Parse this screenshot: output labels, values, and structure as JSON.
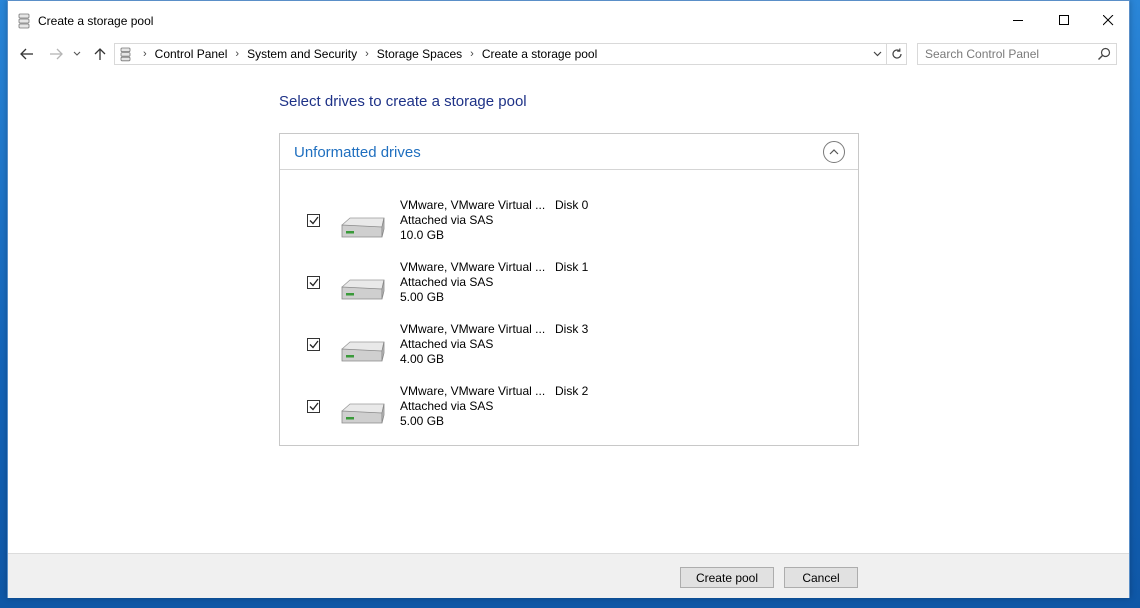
{
  "window": {
    "title": "Create a storage pool"
  },
  "breadcrumb": {
    "items": [
      "Control Panel",
      "System and Security",
      "Storage Spaces",
      "Create a storage pool"
    ]
  },
  "search": {
    "placeholder": "Search Control Panel"
  },
  "main": {
    "heading": "Select drives to create a storage pool",
    "section_title": "Unformatted drives",
    "drives": [
      {
        "name": "VMware, VMware Virtual ...",
        "disk": "Disk 0",
        "connection": "Attached via SAS",
        "size": "10.0 GB",
        "checked": true
      },
      {
        "name": "VMware, VMware Virtual ...",
        "disk": "Disk 1",
        "connection": "Attached via SAS",
        "size": "5.00 GB",
        "checked": true
      },
      {
        "name": "VMware, VMware Virtual ...",
        "disk": "Disk 3",
        "connection": "Attached via SAS",
        "size": "4.00 GB",
        "checked": true
      },
      {
        "name": "VMware, VMware Virtual ...",
        "disk": "Disk 2",
        "connection": "Attached via SAS",
        "size": "5.00 GB",
        "checked": true
      }
    ]
  },
  "footer": {
    "create_label": "Create pool",
    "cancel_label": "Cancel"
  },
  "colors": {
    "heading": "#1e3287",
    "section_title": "#1f6fbf",
    "desktop": "#1a6fc0"
  }
}
